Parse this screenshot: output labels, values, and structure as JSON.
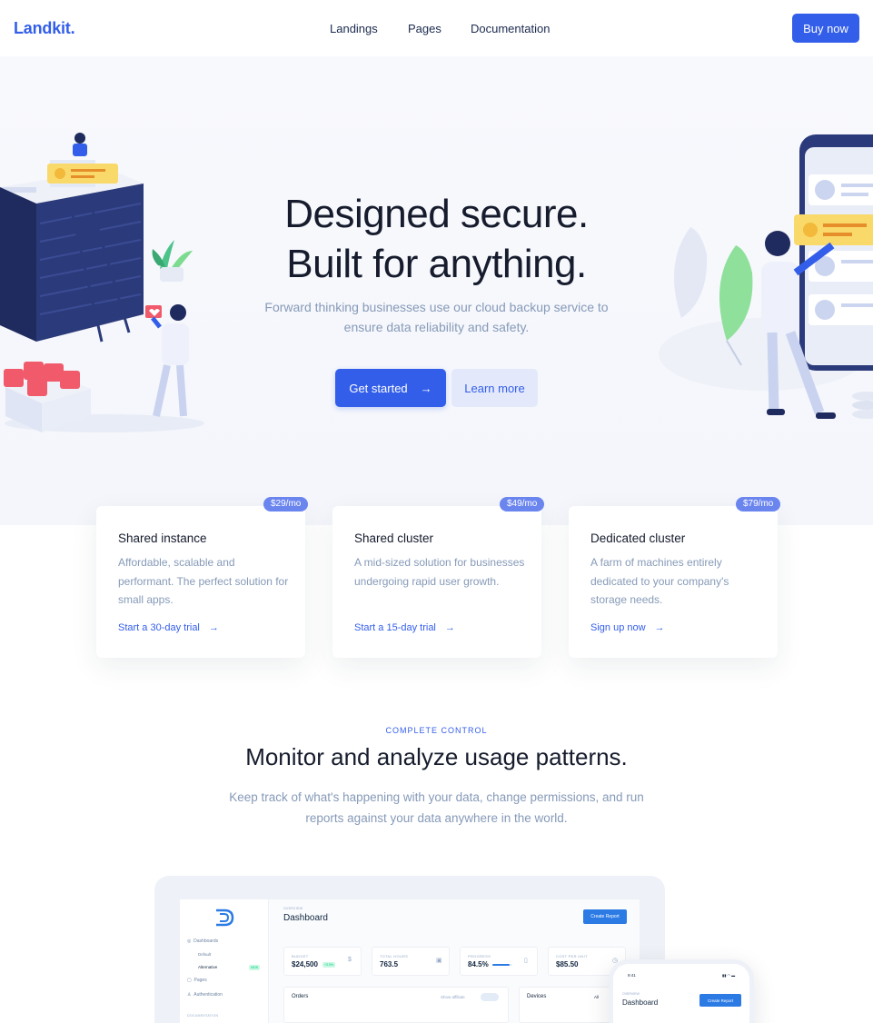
{
  "nav": {
    "brand": "Landkit.",
    "links": [
      "Landings",
      "Pages",
      "Documentation"
    ],
    "cta": "Buy now"
  },
  "hero": {
    "title_line1": "Designed secure.",
    "title_line2": "Built for anything.",
    "subtitle": "Forward thinking businesses use our cloud backup service to ensure data reliability and safety.",
    "primary_btn": "Get started",
    "secondary_btn": "Learn more",
    "arrow": "→"
  },
  "plans": [
    {
      "badge": "$29/mo",
      "title": "Shared instance",
      "text": "Affordable, scalable and performant. The perfect solution for small apps.",
      "link": "Start a 30-day trial"
    },
    {
      "badge": "$49/mo",
      "title": "Shared cluster",
      "text": "A mid-sized solution for businesses undergoing rapid user growth.",
      "link": "Start a 15-day trial"
    },
    {
      "badge": "$79/mo",
      "title": "Dedicated cluster",
      "text": "A farm of machines entirely dedicated to your company's storage needs.",
      "link": "Sign up now"
    }
  ],
  "section": {
    "eyebrow": "COMPLETE CONTROL",
    "title": "Monitor and analyze usage patterns.",
    "subtitle": "Keep track of what's happening with your data, change permissions, and run reports against your data anywhere in the world."
  },
  "dashboard": {
    "overline": "OVERVIEW",
    "title": "Dashboard",
    "create_btn": "Create Report",
    "sidebar": {
      "dashboards": "Dashboards",
      "default": "Default",
      "alternative": "Alternative",
      "new_badge": "NEW",
      "pages": "Pages",
      "authentication": "Authentication",
      "documentation": "DOCUMENTATION"
    },
    "kpis": [
      {
        "label": "BUDGET",
        "value": "$24,500",
        "delta": "+3.5%"
      },
      {
        "label": "TOTAL HOURS",
        "value": "763.5"
      },
      {
        "label": "PROGRESS",
        "value": "84.5%",
        "progress": 84.5
      },
      {
        "label": "COST PER UNIT",
        "value": "$85.50"
      }
    ],
    "orders": "Orders",
    "show_affiliate": "Show affiliate",
    "devices": "Devices",
    "all": "All",
    "phone": {
      "time": "9:41",
      "overline": "OVERVIEW",
      "title": "Dashboard",
      "create_btn": "Create Report"
    }
  },
  "colors": {
    "primary": "#335eea",
    "heading": "#161c2d",
    "muted": "#869ab8",
    "badge": "#6b85ef",
    "soft": "#e3e9fb"
  }
}
